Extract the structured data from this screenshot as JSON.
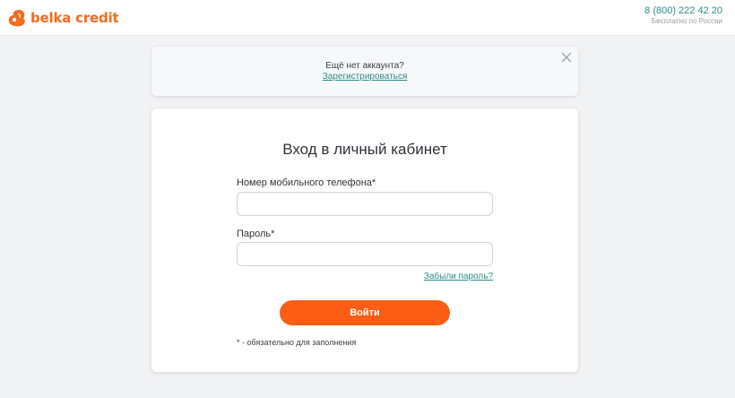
{
  "header": {
    "brand": "belka credit",
    "logo_icon": "squirrel-logo-icon",
    "phone": "8 (800) 222 42 20",
    "phone_note": "Бесплатно по России"
  },
  "banner": {
    "text": "Ещё нет аккаунта?",
    "link": "Зарегистрироваться",
    "close_icon": "close-icon"
  },
  "login": {
    "title": "Вход в личный кабинет",
    "phone_label": "Номер мобильного телефона*",
    "phone_value": "",
    "password_label": "Пароль*",
    "password_value": "",
    "forgot_link": "Забыли пароль?",
    "submit_label": "Войти",
    "required_note": "* - обязательно для заполнения"
  },
  "colors": {
    "brand_orange": "#f36a1d",
    "button_orange": "#fb5d14",
    "link_teal": "#2f8a89",
    "page_background": "#f1f2f4"
  }
}
